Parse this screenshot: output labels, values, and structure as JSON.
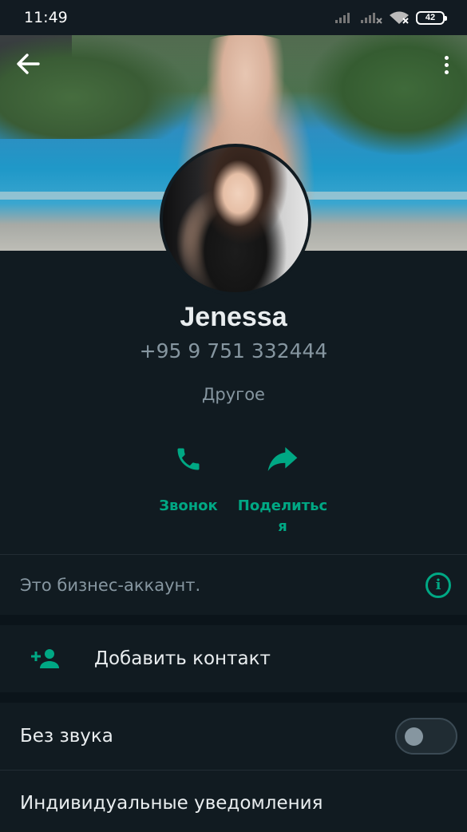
{
  "status_bar": {
    "time": "11:49",
    "battery": "42",
    "icons": [
      "signal-icon",
      "signal-no-service-icon",
      "wifi-icon",
      "battery-icon"
    ]
  },
  "profile": {
    "name": "Jenessa",
    "phone": "+95 9 751 332444",
    "category": "Другое"
  },
  "actions": {
    "call_label": "Звонок",
    "share_label": "Поделиться"
  },
  "business_note": "Это бизнес-аккаунт.",
  "add_contact_label": "Добавить контакт",
  "mute": {
    "label": "Без звука",
    "enabled": false
  },
  "custom_notifications_label": "Индивидуальные уведомления",
  "colors": {
    "background": "#111b21",
    "accent": "#00a884",
    "secondary_text": "#8696a0",
    "primary_text": "#e9edef"
  }
}
